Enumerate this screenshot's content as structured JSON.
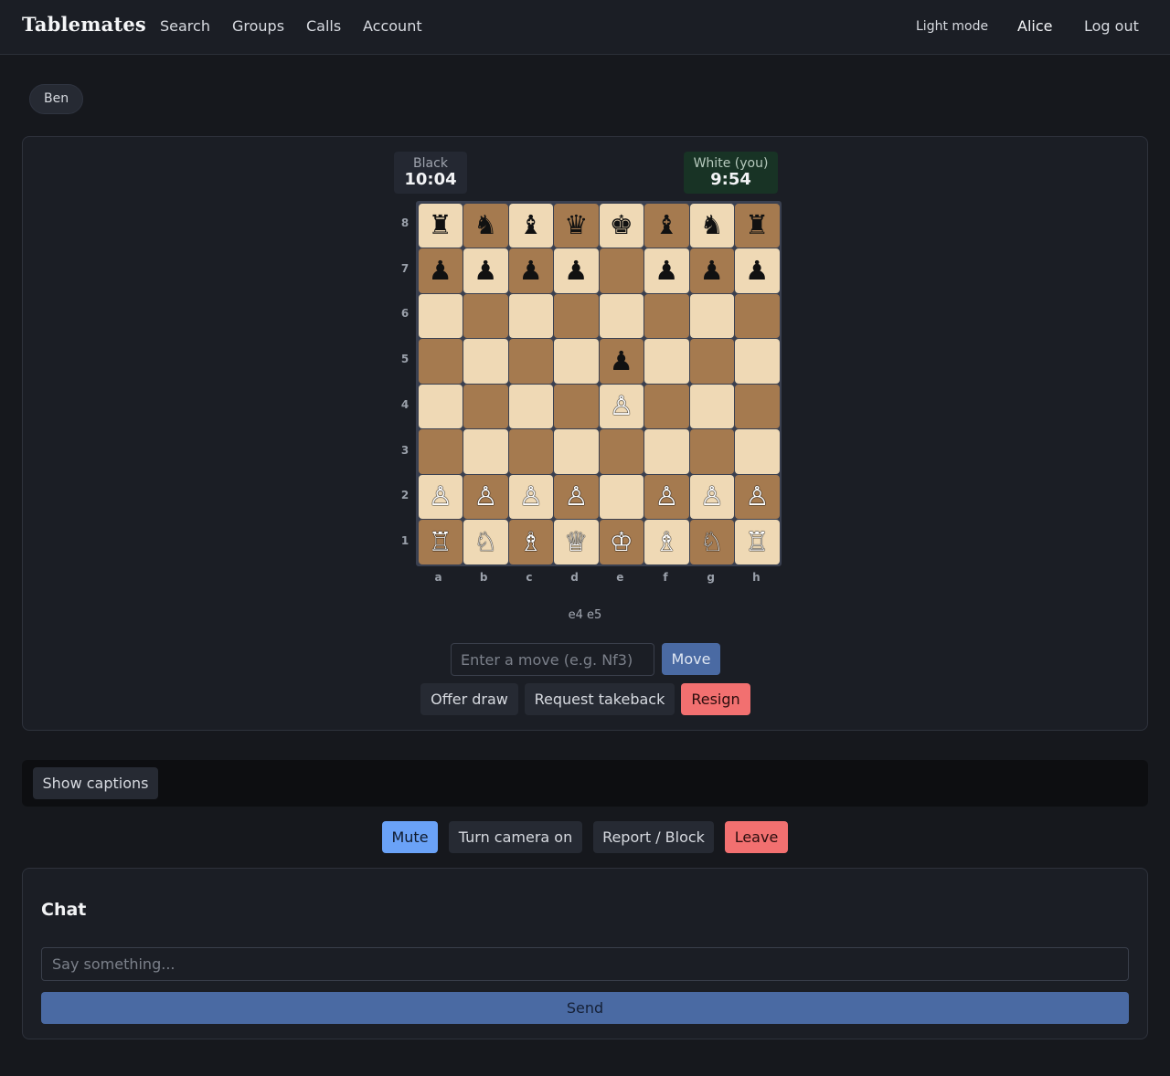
{
  "nav": {
    "brand": "Tablemates",
    "links": [
      "Search",
      "Groups",
      "Calls",
      "Account"
    ],
    "light_mode": "Light mode",
    "user": "Alice",
    "logout": "Log out"
  },
  "opponent": {
    "name": "Ben"
  },
  "clocks": {
    "black": {
      "label": "Black",
      "time": "10:04"
    },
    "white": {
      "label": "White (you)",
      "time": "9:54"
    }
  },
  "board": {
    "ranks": [
      "8",
      "7",
      "6",
      "5",
      "4",
      "3",
      "2",
      "1"
    ],
    "files": [
      "a",
      "b",
      "c",
      "d",
      "e",
      "f",
      "g",
      "h"
    ],
    "position": [
      [
        "♜",
        "♞",
        "♝",
        "♛",
        "♚",
        "♝",
        "♞",
        "♜"
      ],
      [
        "♟",
        "♟",
        "♟",
        "♟",
        "",
        "♟",
        "♟",
        "♟"
      ],
      [
        "",
        "",
        "",
        "",
        "",
        "",
        "",
        ""
      ],
      [
        "",
        "",
        "",
        "",
        "♟",
        "",
        "",
        ""
      ],
      [
        "",
        "",
        "",
        "",
        "♙",
        "",
        "",
        ""
      ],
      [
        "",
        "",
        "",
        "",
        "",
        "",
        "",
        ""
      ],
      [
        "♙",
        "♙",
        "♙",
        "♙",
        "",
        "♙",
        "♙",
        "♙"
      ],
      [
        "♖",
        "♘",
        "♗",
        "♕",
        "♔",
        "♗",
        "♘",
        "♖"
      ]
    ],
    "light_color": "#efd9b5",
    "dark_color": "#a57a4f"
  },
  "moves": "e4 e5",
  "move_form": {
    "placeholder": "Enter a move (e.g. Nf3)",
    "submit": "Move"
  },
  "game_actions": {
    "offer_draw": "Offer draw",
    "takeback": "Request takeback",
    "resign": "Resign"
  },
  "captions": {
    "label": "Show captions"
  },
  "call_actions": {
    "mute": "Mute",
    "camera": "Turn camera on",
    "report": "Report / Block",
    "leave": "Leave"
  },
  "chat": {
    "title": "Chat",
    "placeholder": "Say something...",
    "send": "Send"
  }
}
